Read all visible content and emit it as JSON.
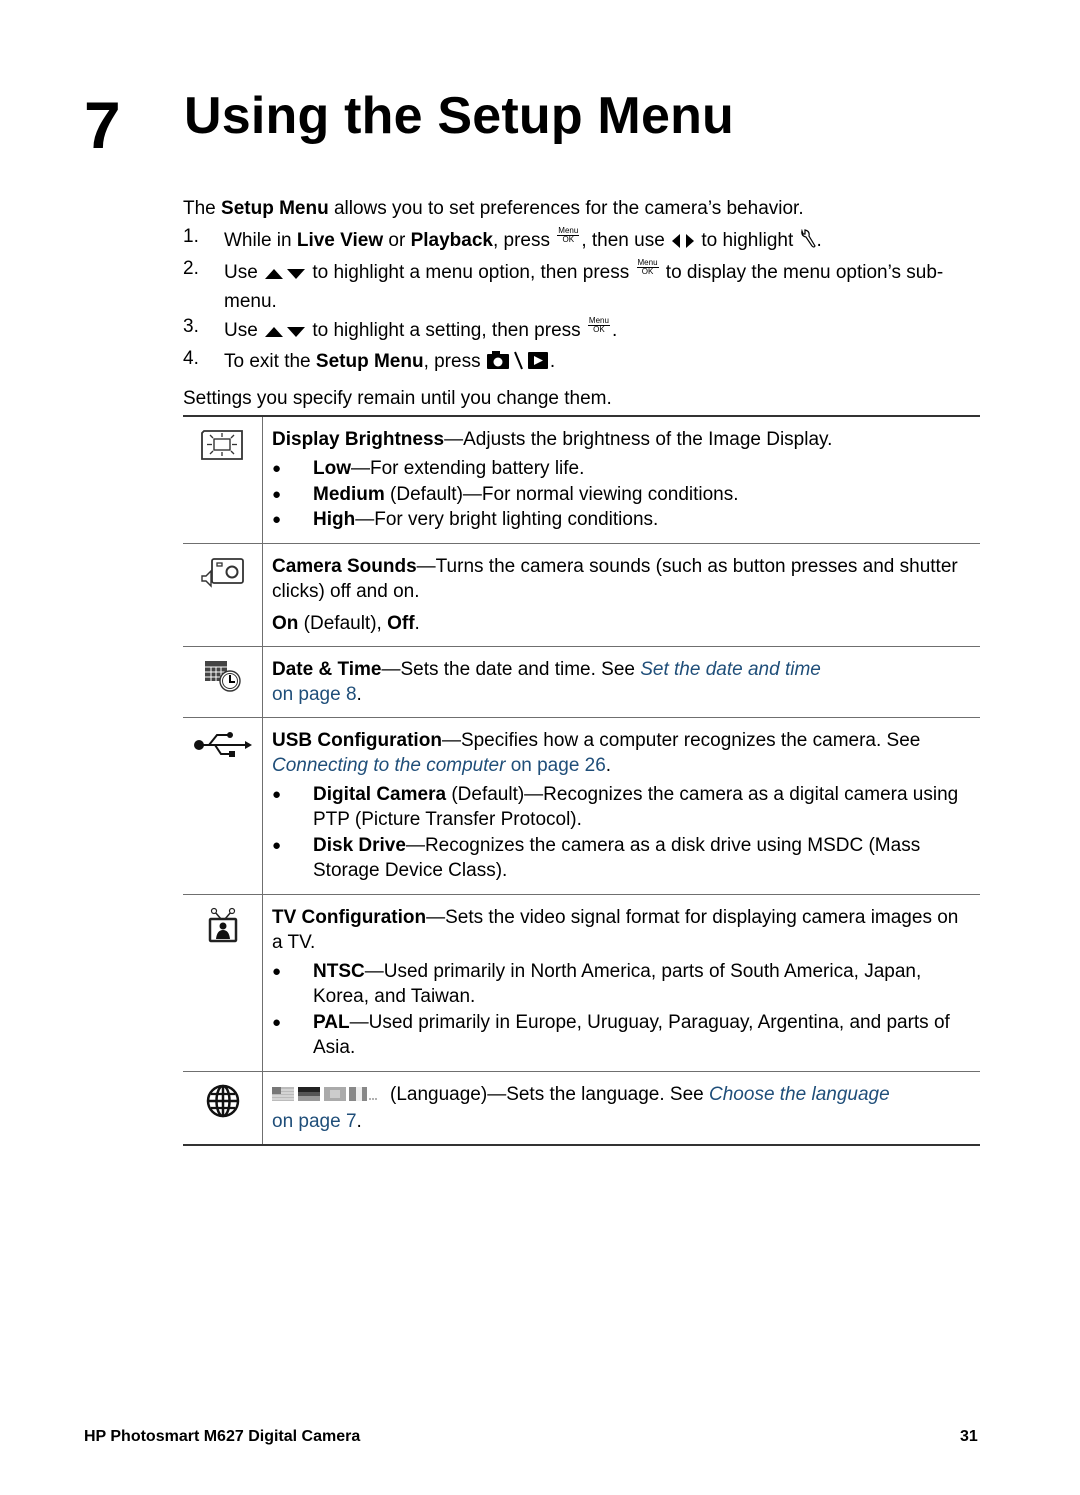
{
  "chapter": {
    "number": "7",
    "title": "Using the Setup Menu"
  },
  "intro": {
    "lead_pre": "The ",
    "lead_bold": "Setup Menu",
    "lead_post": " allows you to set preferences for the camera’s behavior.",
    "steps": [
      {
        "num": "1.",
        "a": "While in ",
        "b1": "Live View",
        "c": " or ",
        "b2": "Playback",
        "d": ", press ",
        "e": ", then use ",
        "f": " to highlight ",
        "g": "."
      },
      {
        "num": "2.",
        "a": "Use ",
        "b": " to highlight a menu option, then press ",
        "c": " to display the menu option’s sub-menu."
      },
      {
        "num": "3.",
        "a": "Use ",
        "b": " to highlight a setting, then press ",
        "c": "."
      },
      {
        "num": "4.",
        "a": "To exit the ",
        "bold": "Setup Menu",
        "c": ", press ",
        "d": "."
      }
    ],
    "outro": "Settings you specify remain until you change them.",
    "menu_ok": {
      "top": "Menu",
      "bottom": "OK"
    },
    "icons": {
      "left_right": "left-right-arrows-icon",
      "up_down": "up-down-arrows-icon",
      "wrench": "wrench-icon",
      "camera_playback": "camera-playback-icon"
    }
  },
  "options": [
    {
      "icon": "display-brightness-icon",
      "title": "Display Brightness",
      "desc": "—Adjusts the brightness of the Image Display.",
      "items": [
        {
          "bold": "Low",
          "text": "—For extending battery life."
        },
        {
          "bold": "Medium",
          "text": " (Default)—For normal viewing conditions."
        },
        {
          "bold": "High",
          "text": "—For very bright lighting conditions."
        }
      ]
    },
    {
      "icon": "camera-sounds-icon",
      "title": "Camera Sounds",
      "desc": "—Turns the camera sounds (such as button presses and shutter clicks) off and on.",
      "values": {
        "on": "On",
        "default": " (Default), ",
        "off": "Off",
        "end": "."
      }
    },
    {
      "icon": "date-time-icon",
      "title": "Date & Time",
      "desc": "—Sets the date and time. See ",
      "link": "Set the date and time",
      "link_page": " on page 8",
      "end": "."
    },
    {
      "icon": "usb-icon",
      "title": "USB Configuration",
      "desc": "—Specifies how a computer recognizes the camera. See ",
      "link": "Connecting to the computer",
      "link_page": " on page 26",
      "end": ".",
      "items": [
        {
          "bold": "Digital Camera",
          "text": "  (Default)—Recognizes the camera as a digital camera using PTP (Picture Transfer Protocol)."
        },
        {
          "bold": "Disk Drive",
          "text": "—Recognizes the camera as a disk drive using MSDC (Mass Storage Device Class)."
        }
      ]
    },
    {
      "icon": "tv-icon",
      "title": "TV Configuration",
      "desc": "—Sets the video signal format for displaying camera images on a TV.",
      "items": [
        {
          "bold": "NTSC",
          "text": "—Used primarily in North America, parts of South America, Japan, Korea, and Taiwan."
        },
        {
          "bold": "PAL",
          "text": "—Used primarily in Europe, Uruguay, Paraguay, Argentina, and parts of Asia."
        }
      ]
    },
    {
      "icon": "globe-icon",
      "flags_icon": "language-flags-icon",
      "desc": "(Language)—Sets the language. See ",
      "link": "Choose the language",
      "link_page": "on page 7",
      "end": "."
    }
  ],
  "footer": {
    "title": "HP Photosmart M627 Digital Camera",
    "page": "31"
  }
}
